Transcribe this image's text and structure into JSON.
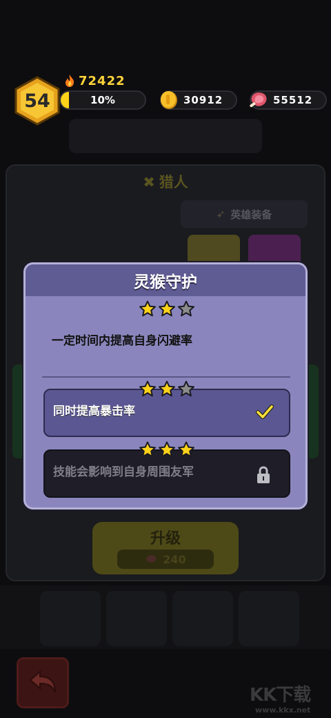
{
  "hud": {
    "level": "54",
    "power": "72422",
    "xp_percent_text": "10%",
    "xp_fraction": 0.1,
    "gold": "30912",
    "meat": "55512"
  },
  "background": {
    "hero_class": "猎人",
    "hero_equip_label": "英雄装备",
    "upgrade_label": "升级",
    "upgrade_cost": "240"
  },
  "modal": {
    "title": "灵猴守护",
    "skill_stars": 2,
    "description": "一定时间内提高自身闪避率",
    "options": [
      {
        "text": "同时提高暴击率",
        "stars": 2,
        "state": "unlocked"
      },
      {
        "text": "技能会影响到自身周围友军",
        "stars": 3,
        "state": "locked"
      }
    ]
  },
  "watermark": {
    "brand": "KK下载",
    "url": "www.kkx.net"
  },
  "colors": {
    "gold_accent": "#ffd21a",
    "modal_body": "#8a86bd",
    "modal_header": "#5f5b93",
    "star_filled": "#ffd21a",
    "star_empty": "#8c8c8c"
  },
  "icons": {
    "power": "flame-icon",
    "gold": "coin-icon",
    "meat": "meat-icon",
    "selected": "check-icon",
    "locked": "lock-icon",
    "back": "back-arrow-icon"
  }
}
